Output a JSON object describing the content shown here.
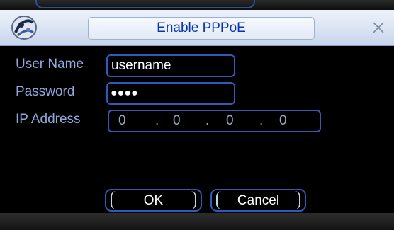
{
  "dialog": {
    "title": "Enable PPPoE"
  },
  "fields": {
    "username_label": "User Name",
    "username_value": "username",
    "password_label": "Password",
    "password_value": "●●●●",
    "ip_label": "IP Address",
    "ip_octets": [
      "0",
      "0",
      "0",
      "0"
    ]
  },
  "buttons": {
    "ok_label": "OK",
    "cancel_label": "Cancel"
  },
  "colors": {
    "title_text": "#0a34b4",
    "label_text": "#8fa8dc",
    "field_border": "#2e5bb8"
  },
  "icons": {
    "logo": "app-logo-icon",
    "close": "close-icon"
  }
}
